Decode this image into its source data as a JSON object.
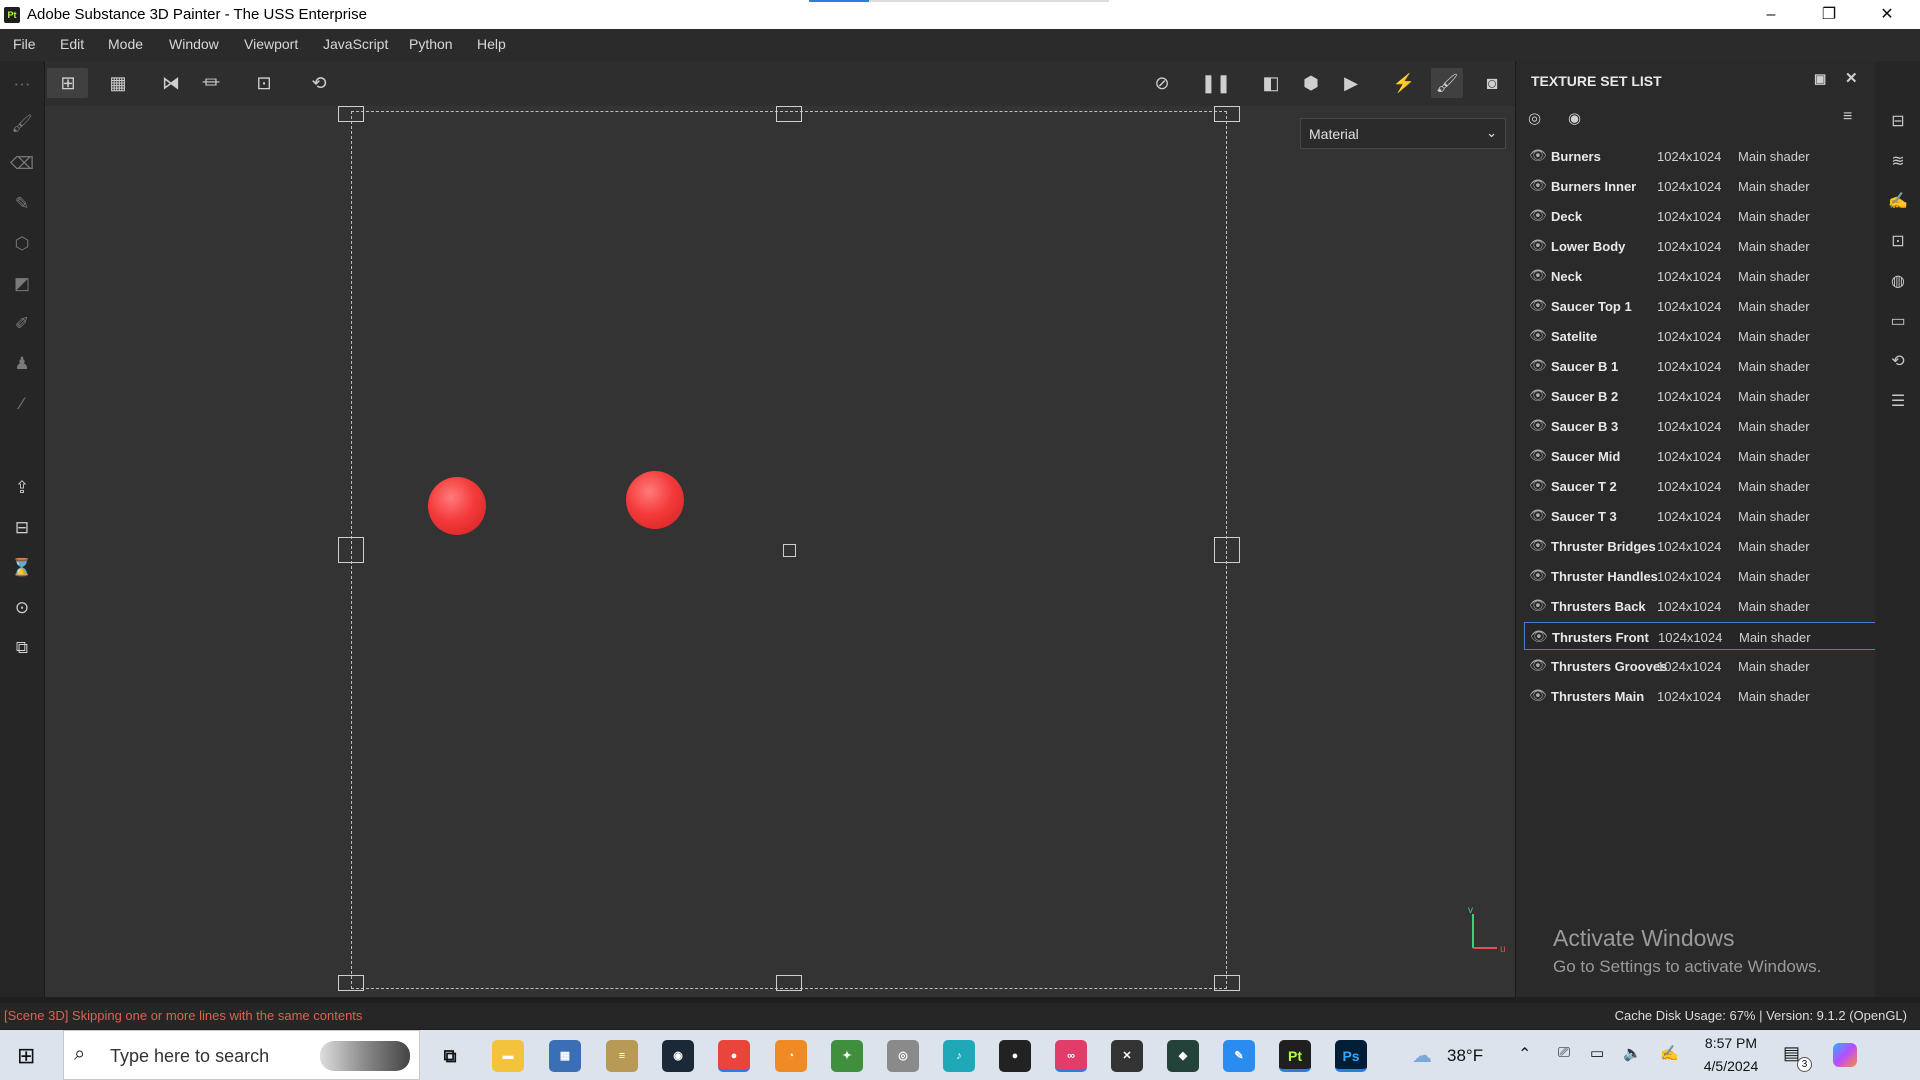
{
  "window": {
    "logo_text": "Pt",
    "title": "Adobe Substance 3D Painter - The USS Enterprise",
    "minimize": "–",
    "maximize": "❐",
    "close": "✕"
  },
  "menu": [
    "File",
    "Edit",
    "Mode",
    "Window",
    "Viewport",
    "JavaScript",
    "Python",
    "Help"
  ],
  "viewport": {
    "material_dropdown": "Material",
    "axis_u": "u",
    "axis_v": "v"
  },
  "texture_set_list": {
    "title": "TEXTURE SET LIST",
    "selected": "Thrusters Front",
    "items": [
      {
        "name": "Burners",
        "resolution": "1024x1024",
        "shader": "Main shader"
      },
      {
        "name": "Burners Inner",
        "resolution": "1024x1024",
        "shader": "Main shader"
      },
      {
        "name": "Deck",
        "resolution": "1024x1024",
        "shader": "Main shader"
      },
      {
        "name": "Lower Body",
        "resolution": "1024x1024",
        "shader": "Main shader"
      },
      {
        "name": "Neck",
        "resolution": "1024x1024",
        "shader": "Main shader"
      },
      {
        "name": "Saucer Top 1",
        "resolution": "1024x1024",
        "shader": "Main shader"
      },
      {
        "name": "Satelite",
        "resolution": "1024x1024",
        "shader": "Main shader"
      },
      {
        "name": "Saucer B 1",
        "resolution": "1024x1024",
        "shader": "Main shader"
      },
      {
        "name": "Saucer B 2",
        "resolution": "1024x1024",
        "shader": "Main shader"
      },
      {
        "name": "Saucer B 3",
        "resolution": "1024x1024",
        "shader": "Main shader"
      },
      {
        "name": "Saucer Mid",
        "resolution": "1024x1024",
        "shader": "Main shader"
      },
      {
        "name": "Saucer T 2",
        "resolution": "1024x1024",
        "shader": "Main shader"
      },
      {
        "name": "Saucer T 3",
        "resolution": "1024x1024",
        "shader": "Main shader"
      },
      {
        "name": "Thruster Bridges",
        "resolution": "1024x1024",
        "shader": "Main shader"
      },
      {
        "name": "Thruster Handles",
        "resolution": "1024x1024",
        "shader": "Main shader"
      },
      {
        "name": "Thrusters Back",
        "resolution": "1024x1024",
        "shader": "Main shader"
      },
      {
        "name": "Thrusters Front",
        "resolution": "1024x1024",
        "shader": "Main shader"
      },
      {
        "name": "Thrusters Grooves",
        "resolution": "1024x1024",
        "shader": "Main shader"
      },
      {
        "name": "Thrusters Main",
        "resolution": "1024x1024",
        "shader": "Main shader"
      }
    ]
  },
  "watermark": {
    "line1": "Activate Windows",
    "line2": "Go to Settings to activate Windows."
  },
  "status": {
    "message": "[Scene 3D] Skipping one or more lines with the same contents",
    "info": "Cache Disk Usage:  67% | Version: 9.1.2 (OpenGL)"
  },
  "taskbar": {
    "search_placeholder": "Type here to search",
    "weather": "38°F",
    "time": "8:57 PM",
    "date": "4/5/2024",
    "notification_count": "3",
    "painter_label": "Pt",
    "photoshop_label": "Ps"
  },
  "colors": {
    "accent": "#4a7bd0",
    "error_text": "#e06050",
    "sphere": "#f43b3b"
  }
}
